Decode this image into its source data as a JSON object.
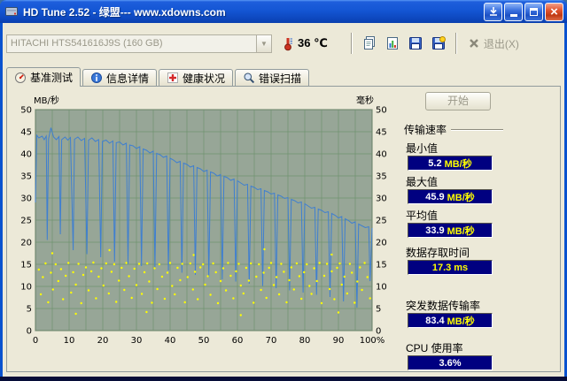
{
  "window": {
    "title": "HD Tune 2.52 - 绿盟--- www.xdowns.com",
    "titlebar_color": "#1456d4",
    "client_bg": "#ece9d8"
  },
  "icons": {
    "titlebar": [
      "app-icon",
      "download-icon",
      "minimize-icon",
      "maximize-icon",
      "close-icon"
    ],
    "toolbar": [
      "temperature-icon",
      "copy-text-icon",
      "copy-image-icon",
      "save-text-icon",
      "save-image-icon",
      "exit-icon"
    ],
    "tabs": [
      "benchmark-icon",
      "info-icon",
      "health-icon",
      "scan-icon"
    ]
  },
  "toolbar": {
    "drive_select_value": "HITACHI HTS541616J9S (160 GB)",
    "temperature": "36 ℃",
    "exit_label": "退出(X)"
  },
  "tabs": [
    {
      "label": "基准测试",
      "active": true
    },
    {
      "label": "信息详情",
      "active": false
    },
    {
      "label": "健康状况",
      "active": false
    },
    {
      "label": "错误扫描",
      "active": false
    }
  ],
  "benchmark": {
    "start_button": "开始",
    "section_title": "传输速率",
    "box_bg": "#000080",
    "value_color": "#ffffff",
    "unit_color": "#ffff00",
    "rows": [
      {
        "label": "最小值",
        "value": "5.2",
        "unit": "MB/秒"
      },
      {
        "label": "最大值",
        "value": "45.9",
        "unit": "MB/秒"
      },
      {
        "label": "平均值",
        "value": "33.9",
        "unit": "MB/秒"
      },
      {
        "label": "数据存取时间",
        "value": "17.3",
        "unit": "ms"
      },
      {
        "label": "突发数据传输率",
        "value": "83.4",
        "unit": "MB/秒"
      },
      {
        "label": "CPU 使用率",
        "value": "3.6%",
        "unit": ""
      }
    ]
  },
  "chart_data": {
    "type": "line",
    "title": "",
    "ylabel_left": "MB/秒",
    "ylabel_right": "毫秒",
    "x_range": [
      0,
      100
    ],
    "y_range": [
      0,
      50
    ],
    "x_ticks": [
      0,
      10,
      20,
      30,
      40,
      50,
      60,
      70,
      80,
      90
    ],
    "x_max_label": "100%",
    "y_tick_step": 5,
    "grid_step_x": 5,
    "grid_step_y": 5,
    "grid": true,
    "legend": "none",
    "colors": {
      "plot_bg": "#97a697",
      "grid": "#6f936f",
      "border": "#4d4d4d",
      "line": "#3f7fd0",
      "dots": "#ffff00"
    },
    "series": [
      {
        "name": "传输速率 (MB/秒)",
        "type": "line",
        "points": [
          [
            0,
            29
          ],
          [
            0.4,
            44.2
          ],
          [
            1,
            43.6
          ],
          [
            2,
            44
          ],
          [
            2.6,
            43.2
          ],
          [
            3.2,
            44
          ],
          [
            3.5,
            20.5
          ],
          [
            3.9,
            43.4
          ],
          [
            4.6,
            45.9
          ],
          [
            5.4,
            43.8
          ],
          [
            6.2,
            43.2
          ],
          [
            7,
            43.9
          ],
          [
            7.4,
            21.8
          ],
          [
            7.8,
            43.2
          ],
          [
            8.8,
            43.8
          ],
          [
            9.6,
            43.1
          ],
          [
            10.4,
            43.7
          ],
          [
            11.2,
            18.2
          ],
          [
            11.6,
            43.3
          ],
          [
            12.6,
            43.8
          ],
          [
            13.6,
            43
          ],
          [
            14.6,
            43.5
          ],
          [
            15.3,
            17.3
          ],
          [
            15.8,
            43.1
          ],
          [
            16.8,
            43.6
          ],
          [
            17.8,
            42.8
          ],
          [
            18.8,
            43.2
          ],
          [
            19.4,
            16.6
          ],
          [
            19.9,
            42.8
          ],
          [
            21,
            43.1
          ],
          [
            22,
            42.4
          ],
          [
            23,
            42.9
          ],
          [
            23.5,
            15.6
          ],
          [
            24,
            42.5
          ],
          [
            25,
            42.7
          ],
          [
            26,
            42
          ],
          [
            27,
            42.4
          ],
          [
            27.5,
            15.1
          ],
          [
            28,
            42
          ],
          [
            29,
            41.8
          ],
          [
            30,
            41.2
          ],
          [
            31,
            41.6
          ],
          [
            31.5,
            14.6
          ],
          [
            32,
            41.1
          ],
          [
            33,
            40.8
          ],
          [
            34,
            40.2
          ],
          [
            35,
            40.6
          ],
          [
            35.5,
            14
          ],
          [
            36,
            40.1
          ],
          [
            37,
            39.8
          ],
          [
            38,
            39.2
          ],
          [
            39,
            39.5
          ],
          [
            39.5,
            13.6
          ],
          [
            40,
            39
          ],
          [
            41,
            38.6
          ],
          [
            42,
            38
          ],
          [
            43,
            38.3
          ],
          [
            43.5,
            13.1
          ],
          [
            44,
            37.9
          ],
          [
            45,
            37.6
          ],
          [
            46,
            37
          ],
          [
            47,
            37.3
          ],
          [
            47.5,
            12.6
          ],
          [
            48,
            36.9
          ],
          [
            49,
            36.6
          ],
          [
            50,
            36
          ],
          [
            51,
            36.3
          ],
          [
            51.5,
            12.1
          ],
          [
            52,
            35.9
          ],
          [
            53,
            35.6
          ],
          [
            54,
            35
          ],
          [
            55,
            35.3
          ],
          [
            55.5,
            11.6
          ],
          [
            56,
            34.9
          ],
          [
            57,
            34.6
          ],
          [
            58,
            34
          ],
          [
            59,
            34.3
          ],
          [
            59.5,
            11.1
          ],
          [
            60,
            33.9
          ],
          [
            61,
            33.4
          ],
          [
            62,
            32.9
          ],
          [
            63,
            33.1
          ],
          [
            63.5,
            10.6
          ],
          [
            64,
            32.7
          ],
          [
            65,
            32.4
          ],
          [
            66,
            31.9
          ],
          [
            67,
            32.1
          ],
          [
            67.5,
            10.1
          ],
          [
            68,
            31.7
          ],
          [
            69,
            31.4
          ],
          [
            70,
            30.9
          ],
          [
            71,
            31.1
          ],
          [
            71.5,
            9.6
          ],
          [
            72,
            30.7
          ],
          [
            73,
            30.4
          ],
          [
            74,
            29.9
          ],
          [
            75,
            30.1
          ],
          [
            75.5,
            9.1
          ],
          [
            76,
            29.7
          ],
          [
            77,
            29.4
          ],
          [
            78,
            28.9
          ],
          [
            79,
            29.1
          ],
          [
            79.5,
            8.6
          ],
          [
            80,
            28.7
          ],
          [
            81,
            28.2
          ],
          [
            82,
            27.7
          ],
          [
            83,
            27.9
          ],
          [
            83.5,
            8.1
          ],
          [
            84,
            27.5
          ],
          [
            85,
            27.2
          ],
          [
            86,
            26.7
          ],
          [
            87,
            26.9
          ],
          [
            87.5,
            7.6
          ],
          [
            88,
            26.5
          ],
          [
            89,
            26.1
          ],
          [
            90,
            25.5
          ],
          [
            91,
            25.8
          ],
          [
            91.5,
            6.6
          ],
          [
            92,
            25.3
          ],
          [
            93,
            24.9
          ],
          [
            94,
            24.3
          ],
          [
            95,
            24.6
          ],
          [
            95.5,
            5.2
          ],
          [
            96,
            24.1
          ],
          [
            97,
            23.7
          ],
          [
            98,
            23.3
          ],
          [
            99,
            23.5
          ],
          [
            99.4,
            11.2
          ],
          [
            100,
            23.2
          ]
        ]
      },
      {
        "name": "存取时间 (毫秒)",
        "type": "scatter",
        "points": [
          [
            1,
            13.8
          ],
          [
            1.6,
            8.2
          ],
          [
            2.2,
            12.1
          ],
          [
            3,
            15.2
          ],
          [
            3.8,
            6.4
          ],
          [
            4.6,
            13.1
          ],
          [
            5,
            17.5
          ],
          [
            5.2,
            9.3
          ],
          [
            6,
            15
          ],
          [
            6.8,
            11.2
          ],
          [
            7.6,
            13.9
          ],
          [
            8.2,
            7.1
          ],
          [
            9,
            12.4
          ],
          [
            9.8,
            15.3
          ],
          [
            10.6,
            8.6
          ],
          [
            11.2,
            13.2
          ],
          [
            12,
            10.4
          ],
          [
            12,
            3.8
          ],
          [
            12.8,
            15.1
          ],
          [
            13.6,
            6.2
          ],
          [
            14.2,
            12.6
          ],
          [
            15,
            14.3
          ],
          [
            15.8,
            9.1
          ],
          [
            16.6,
            13.4
          ],
          [
            17.2,
            15.4
          ],
          [
            18,
            7.3
          ],
          [
            18.8,
            12.2
          ],
          [
            19.6,
            14.1
          ],
          [
            20.2,
            10.2
          ],
          [
            21,
            15.2
          ],
          [
            21.8,
            8.4
          ],
          [
            22,
            18.2
          ],
          [
            22.6,
            13.3
          ],
          [
            23.4,
            15
          ],
          [
            24,
            6.5
          ],
          [
            24.8,
            11.3
          ],
          [
            25.6,
            14.2
          ],
          [
            26.4,
            9.2
          ],
          [
            27,
            15.3
          ],
          [
            27.8,
            12.3
          ],
          [
            28.6,
            7.4
          ],
          [
            29.4,
            14
          ],
          [
            30,
            10.3
          ],
          [
            30.8,
            15.1
          ],
          [
            31.6,
            8.3
          ],
          [
            32.4,
            13.2
          ],
          [
            33,
            4.2
          ],
          [
            33.2,
            15.2
          ],
          [
            33.8,
            11.1
          ],
          [
            34.6,
            6.3
          ],
          [
            35.4,
            14.1
          ],
          [
            36.2,
            9.4
          ],
          [
            36.8,
            15
          ],
          [
            37.6,
            12.2
          ],
          [
            38.4,
            7.2
          ],
          [
            39.2,
            13.1
          ],
          [
            40,
            15.3
          ],
          [
            40.6,
            10.1
          ],
          [
            41.4,
            8.2
          ],
          [
            42.2,
            14.2
          ],
          [
            43,
            11.4
          ],
          [
            43.6,
            15.1
          ],
          [
            44.4,
            6.4
          ],
          [
            45.2,
            12.1
          ],
          [
            46,
            15.2
          ],
          [
            46.8,
            9.3
          ],
          [
            47,
            17.1
          ],
          [
            47.4,
            13.3
          ],
          [
            48.2,
            7.1
          ],
          [
            49,
            14.3
          ],
          [
            49.8,
            15
          ],
          [
            50.4,
            10.4
          ],
          [
            51.2,
            12.3
          ],
          [
            52,
            8.1
          ],
          [
            52.8,
            15.2
          ],
          [
            53.6,
            13.2
          ],
          [
            54.2,
            6.2
          ],
          [
            55,
            11.2
          ],
          [
            55.8,
            14.1
          ],
          [
            56.6,
            9.1
          ],
          [
            57.2,
            15.3
          ],
          [
            58,
            12.4
          ],
          [
            58.8,
            7.3
          ],
          [
            59.6,
            13.4
          ],
          [
            60.4,
            15.1
          ],
          [
            61,
            10.2
          ],
          [
            61,
            3.5
          ],
          [
            61.8,
            8.4
          ],
          [
            62.6,
            14.2
          ],
          [
            63.4,
            11.3
          ],
          [
            64,
            15.2
          ],
          [
            64.8,
            6.3
          ],
          [
            65.6,
            12.2
          ],
          [
            66.4,
            15
          ],
          [
            67,
            9.2
          ],
          [
            67.8,
            13.1
          ],
          [
            68,
            18.4
          ],
          [
            68.6,
            7.4
          ],
          [
            69.4,
            14.2
          ],
          [
            70,
            15.3
          ],
          [
            70.8,
            10.3
          ],
          [
            71.6,
            12.1
          ],
          [
            72.4,
            8.2
          ],
          [
            73,
            15.1
          ],
          [
            73.8,
            13.3
          ],
          [
            74.6,
            6.4
          ],
          [
            75.4,
            11.4
          ],
          [
            76,
            14.3
          ],
          [
            76.8,
            9.3
          ],
          [
            77.6,
            15.2
          ],
          [
            78.4,
            12.3
          ],
          [
            79,
            7.2
          ],
          [
            79.8,
            13.2
          ],
          [
            80.6,
            15
          ],
          [
            81.4,
            10.1
          ],
          [
            82,
            8.3
          ],
          [
            82.8,
            14.1
          ],
          [
            83.6,
            11.2
          ],
          [
            84.4,
            15.3
          ],
          [
            85,
            6.2
          ],
          [
            85.8,
            12.4
          ],
          [
            86.6,
            15.1
          ],
          [
            87.4,
            9.4
          ],
          [
            88,
            13.4
          ],
          [
            88,
            17.2
          ],
          [
            88.8,
            7.1
          ],
          [
            89.6,
            14.2
          ],
          [
            90,
            4.1
          ],
          [
            90.4,
            15.2
          ],
          [
            91,
            10.4
          ],
          [
            91.8,
            12.2
          ],
          [
            92.6,
            8.4
          ],
          [
            93.4,
            15.1
          ],
          [
            94,
            13.1
          ],
          [
            94.8,
            6.3
          ],
          [
            95.6,
            11.1
          ],
          [
            96.4,
            14.3
          ],
          [
            97,
            9.2
          ],
          [
            97.8,
            15.3
          ],
          [
            98.6,
            12.1
          ],
          [
            99.4,
            7.3
          ]
        ]
      }
    ]
  }
}
